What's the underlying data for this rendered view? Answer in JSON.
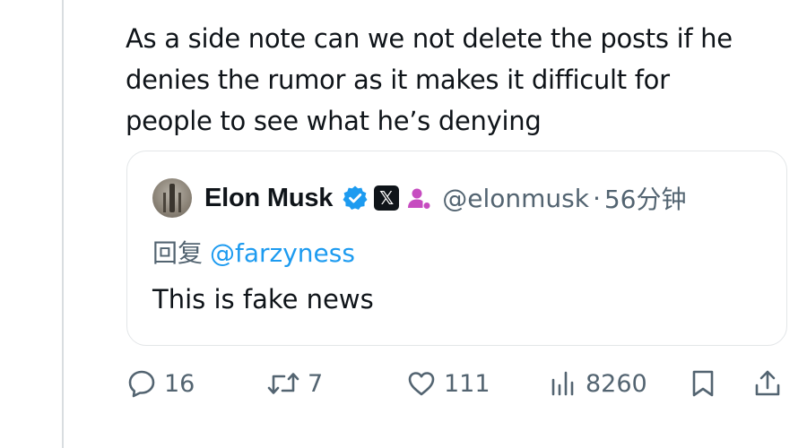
{
  "post": {
    "text_lines": [
      "As a side note can we not delete the posts if he",
      "denies the rumor as it makes it difficult for",
      "people to see what he’s denying"
    ]
  },
  "quoted_post": {
    "author_name": "Elon Musk",
    "handle": "@elonmusk",
    "separator": "·",
    "time": "56分钟",
    "x_badge": "𝕏",
    "reply_prefix": "回复",
    "reply_mention": "@farzyness",
    "body": "This is fake news",
    "icons": [
      "verified-icon",
      "x-badge-icon",
      "affiliate-icon"
    ]
  },
  "actions": {
    "replies": "16",
    "reposts": "7",
    "likes": "111",
    "views": "8260",
    "icons": [
      "reply-icon",
      "repost-icon",
      "like-icon",
      "views-icon",
      "bookmark-icon",
      "share-icon"
    ]
  },
  "colors": {
    "text": "#0f1419",
    "secondary": "#536471",
    "link": "#1d9bf0",
    "verified": "#1d9bf0",
    "affiliate": "#c64cc0",
    "border": "#e3e6e8"
  }
}
